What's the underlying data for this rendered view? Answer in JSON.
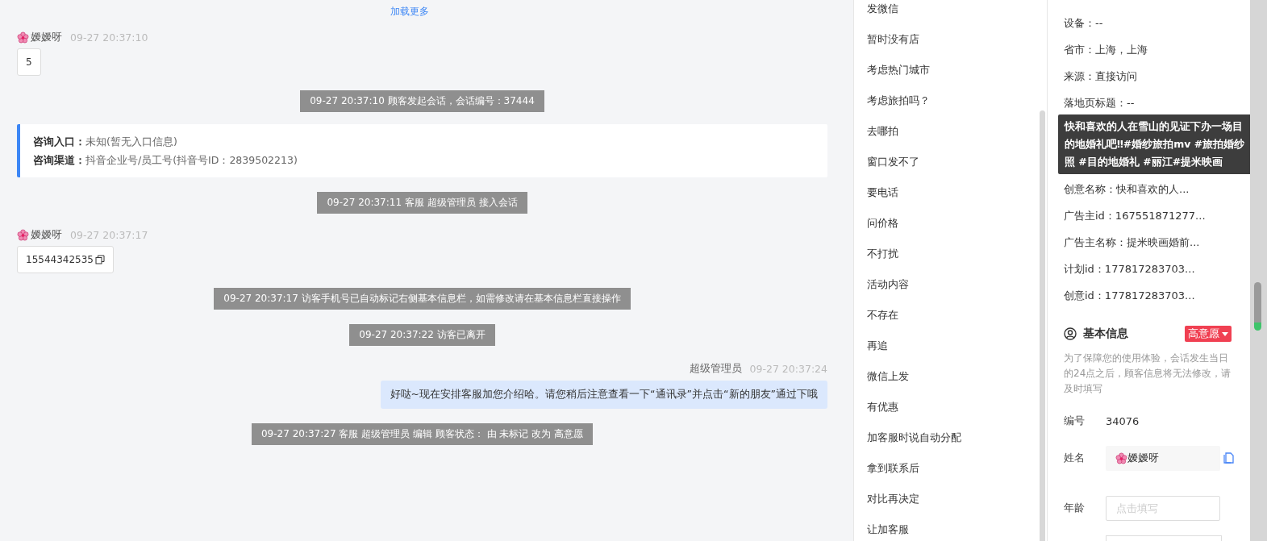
{
  "chat": {
    "load_more": "加载更多",
    "messages": [
      {
        "kind": "visitor",
        "name": "嫒嫒呀",
        "time": "09-27 20:37:10",
        "text": "5",
        "copy": false
      },
      {
        "kind": "system",
        "text": "09-27 20:37:10 顾客发起会话，会话编号：37444"
      },
      {
        "kind": "entry",
        "lines": [
          {
            "label": "咨询入口：",
            "value": "未知(暂无入口信息)"
          },
          {
            "label": "咨询渠道：",
            "value": "抖音企业号/员工号(抖音号ID：2839502213)"
          }
        ]
      },
      {
        "kind": "system",
        "text": "09-27 20:37:11 客服 超级管理员 接入会话"
      },
      {
        "kind": "visitor",
        "name": "嫒嫒呀",
        "time": "09-27 20:37:17",
        "text": "15544342535",
        "copy": true
      },
      {
        "kind": "system",
        "text": "09-27 20:37:17 访客手机号已自动标记右侧基本信息栏，如需修改请在基本信息栏直接操作"
      },
      {
        "kind": "system",
        "text": "09-27 20:37:22 访客已离开"
      },
      {
        "kind": "agent",
        "name": "超级管理员",
        "time": "09-27 20:37:24",
        "text": "好哒~现在安排客服加您介绍哈。请您稍后注意查看一下“通讯录”并点击“新的朋友”通过下哦"
      },
      {
        "kind": "system",
        "text": "09-27 20:37:27 客服 超级管理员 编辑 顾客状态： 由 未标记 改为 高意愿"
      }
    ]
  },
  "quick_replies": [
    "发微信",
    "暂时没有店",
    "考虑热门城市",
    "考虑旅拍吗？",
    "去哪拍",
    "窗口发不了",
    "要电话",
    "问价格",
    "不打扰",
    "活动内容",
    "不存在",
    "再追",
    "微信上发",
    "有优惠",
    "加客服时说自动分配",
    "拿到联系后",
    "对比再决定",
    "让加客服"
  ],
  "info": {
    "rows_top": [
      "设备：--",
      "省市：上海，上海",
      "来源：直接访问",
      "落地页标题：--"
    ],
    "tooltip": "快和喜欢的人在雪山的见证下办一场目的地婚礼吧‼#婚纱旅拍mv #旅拍婚纱照 #目的地婚礼 #丽江#提米映画",
    "rows_bottom": [
      "创意名称：快和喜欢的人...",
      "广告主id：167551871277...",
      "广告主名称：提米映画婚前...",
      "计划id：177817283703...",
      "创意id：177817283703..."
    ],
    "basic": {
      "title": "基本信息",
      "tag": "高意愿",
      "note": "为了保障您的使用体验，会话发生当日的24点之后，顾客信息将无法修改，请及时填写",
      "fields": [
        {
          "kind": "text",
          "label": "编号",
          "value": "34076"
        },
        {
          "kind": "name",
          "label": "姓名",
          "value": "嫒嫒呀"
        },
        {
          "kind": "input",
          "label": "年龄",
          "placeholder": "点击填写"
        }
      ]
    }
  }
}
